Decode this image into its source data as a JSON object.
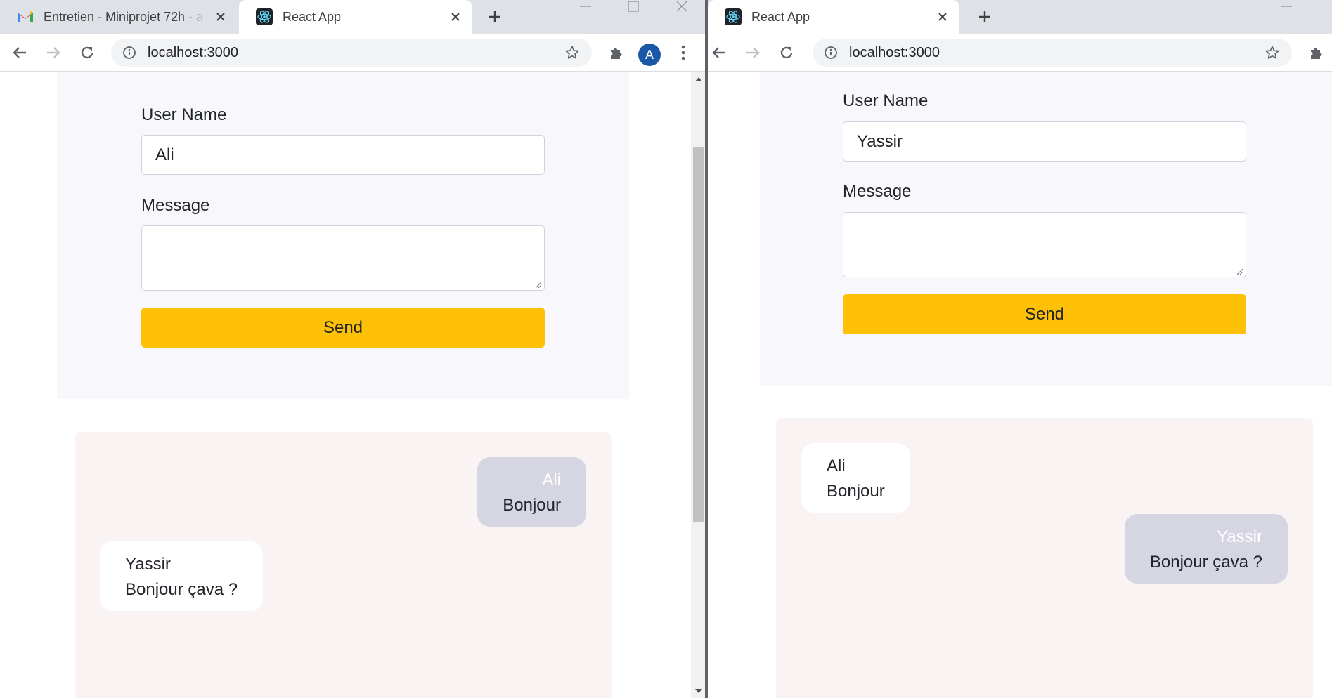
{
  "left_window": {
    "tabs": [
      {
        "title": "Entretien - Miniprojet 72h - a",
        "favicon": "gmail-icon"
      },
      {
        "title": "React App",
        "favicon": "react-icon",
        "active": true
      }
    ],
    "url": "localhost:3000",
    "profile_initial": "A",
    "form": {
      "username_label": "User Name",
      "username_value": "Ali",
      "message_label": "Message",
      "message_value": "",
      "send_label": "Send"
    },
    "messages": [
      {
        "author": "Ali",
        "text": "Bonjour",
        "own": true
      },
      {
        "author": "Yassir",
        "text": "Bonjour çava ?",
        "own": false
      }
    ]
  },
  "right_window": {
    "tabs": [
      {
        "title": "React App",
        "favicon": "react-icon",
        "active": true
      }
    ],
    "url": "localhost:3000",
    "form": {
      "username_label": "User Name",
      "username_value": "Yassir",
      "message_label": "Message",
      "message_value": "",
      "send_label": "Send"
    },
    "messages": [
      {
        "author": "Ali",
        "text": "Bonjour",
        "own": false
      },
      {
        "author": "Yassir",
        "text": "Bonjour çava ?",
        "own": true
      }
    ]
  },
  "colors": {
    "send_button": "#ffc107",
    "own_bubble": "#d6d6e2",
    "other_bubble": "#ffffff",
    "chat_panel": "#faf3f3",
    "form_panel": "#f8f8fc",
    "avatar": "#1a57a6",
    "tabstrip": "#dee1e6"
  }
}
